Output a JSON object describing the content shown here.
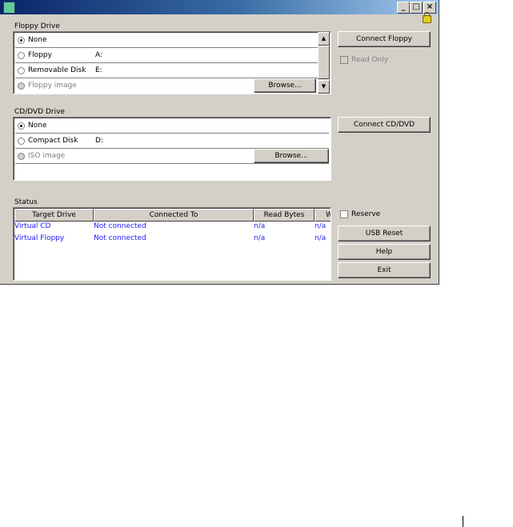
{
  "titlebar": {
    "minimize": "_",
    "maximize": "□",
    "close": "×"
  },
  "floppy": {
    "label": "Floppy Drive",
    "options": [
      {
        "label": "None",
        "device": "",
        "selected": true,
        "disabled": false
      },
      {
        "label": "Floppy",
        "device": "A:",
        "selected": false,
        "disabled": false
      },
      {
        "label": "Removable Disk",
        "device": "E:",
        "selected": false,
        "disabled": false
      },
      {
        "label": "Floppy image",
        "device": "",
        "selected": false,
        "disabled": true
      }
    ],
    "browse": "Browse...",
    "connect": "Connect Floppy",
    "read_only": "Read Only"
  },
  "cd": {
    "label": "CD/DVD Drive",
    "options": [
      {
        "label": "None",
        "device": "",
        "selected": true
      },
      {
        "label": "Compact Disk",
        "device": "D:",
        "selected": false
      },
      {
        "label": "ISO image",
        "device": "",
        "selected": false,
        "disabled": true
      }
    ],
    "browse": "Browse...",
    "connect": "Connect CD/DVD"
  },
  "status": {
    "label": "Status",
    "columns": [
      "Target Drive",
      "Connected To",
      "Read Bytes",
      "W"
    ],
    "rows": [
      [
        "Virtual CD",
        "Not connected",
        "n/a",
        "n/a"
      ],
      [
        "Virtual Floppy",
        "Not connected",
        "n/a",
        "n/a"
      ]
    ]
  },
  "side": {
    "reserve": "Reserve",
    "usb_reset": "USB Reset",
    "help": "Help",
    "exit": "Exit"
  }
}
